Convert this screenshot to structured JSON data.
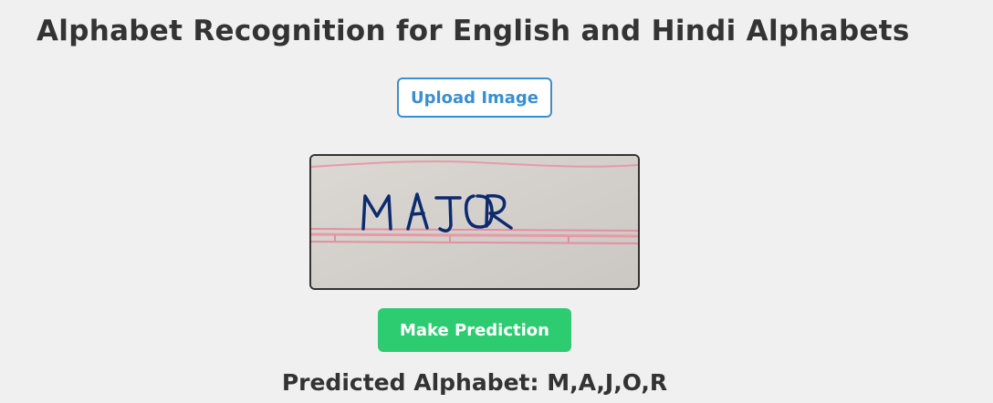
{
  "page": {
    "title": "Alphabet Recognition for English and Hindi Alphabets"
  },
  "upload": {
    "label": "Upload Image"
  },
  "preview": {
    "handwritten_text": "MAJOR"
  },
  "predict": {
    "label": "Make Prediction"
  },
  "result": {
    "label": "Predicted Alphabet:",
    "value": "M,A,J,O,R"
  },
  "colors": {
    "background": "#f0f0f0",
    "upload_accent": "#3a8fd0",
    "predict_button": "#2ecc71",
    "text": "#333333",
    "ink": "#0c2b6e",
    "paper_line": "#e79aa6"
  }
}
